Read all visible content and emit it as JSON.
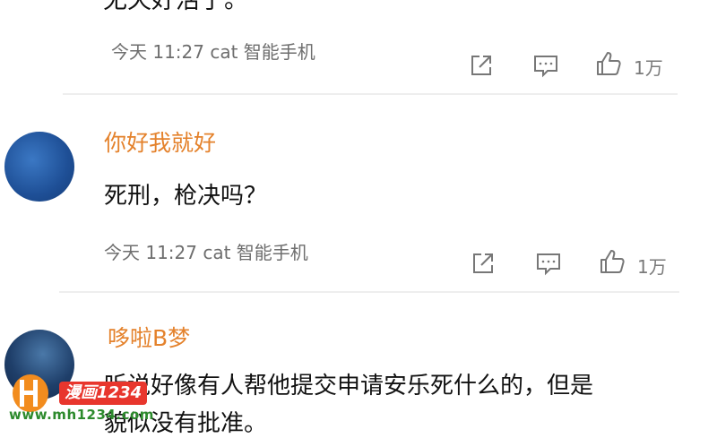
{
  "comment1": {
    "text_cut": "无天好活了。",
    "meta": "今天 11:27 cat 智能手机",
    "like_count": "1万"
  },
  "comment2": {
    "username": "你好我就好",
    "text": "死刑，枪决吗？",
    "meta": "今天 11:27 cat 智能手机",
    "like_count": "1万"
  },
  "comment3": {
    "username": "哆啦B梦",
    "text": "听说好像有人帮他提交申请安乐死什么的，但是",
    "text_line2": "貌似没有批准。"
  },
  "watermark": {
    "badge": "漫画1234",
    "url": "www.mh1234.com"
  },
  "icons": {
    "share": "share-icon",
    "comment": "comment-icon",
    "like": "thumbs-up-icon"
  },
  "colors": {
    "username": "#e4822c",
    "meta": "#6e6e6e",
    "divider": "#eeeeee"
  }
}
